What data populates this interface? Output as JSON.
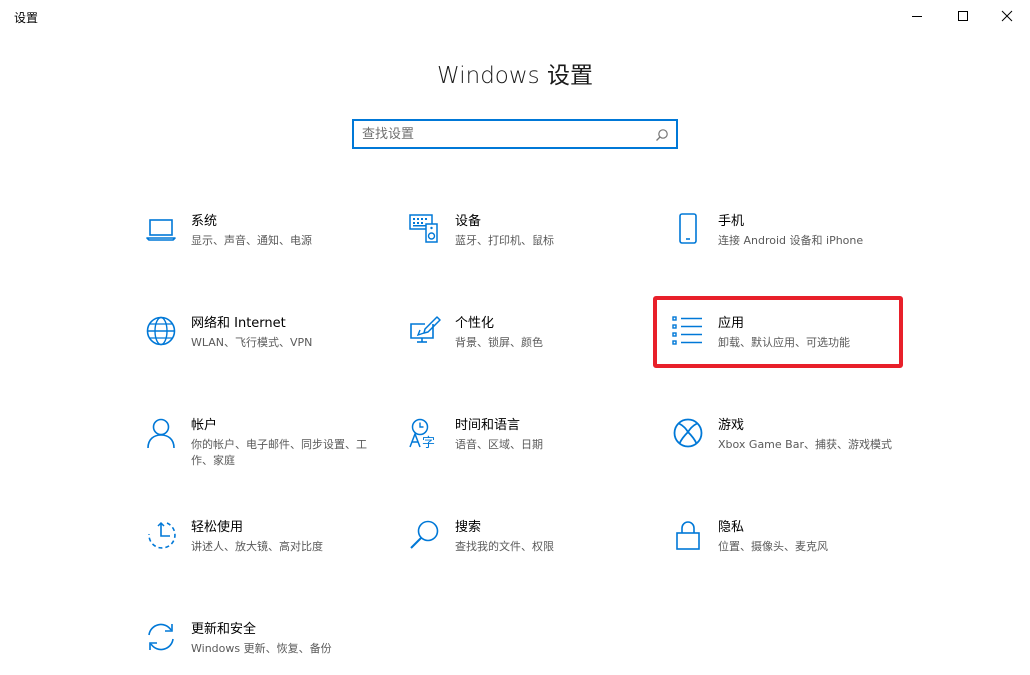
{
  "window": {
    "title": "设置"
  },
  "header": {
    "title": "Windows 设置"
  },
  "search": {
    "placeholder": "查找设置"
  },
  "tiles": [
    {
      "title": "系统",
      "subtitle": "显示、声音、通知、电源",
      "icon": "laptop-icon"
    },
    {
      "title": "设备",
      "subtitle": "蓝牙、打印机、鼠标",
      "icon": "devices-icon"
    },
    {
      "title": "手机",
      "subtitle": "连接 Android 设备和 iPhone",
      "icon": "phone-icon"
    },
    {
      "title": "网络和 Internet",
      "subtitle": "WLAN、飞行模式、VPN",
      "icon": "globe-icon"
    },
    {
      "title": "个性化",
      "subtitle": "背景、锁屏、颜色",
      "icon": "personalization-icon"
    },
    {
      "title": "应用",
      "subtitle": "卸载、默认应用、可选功能",
      "icon": "apps-list-icon"
    },
    {
      "title": "帐户",
      "subtitle": "你的帐户、电子邮件、同步设置、工作、家庭",
      "icon": "person-icon"
    },
    {
      "title": "时间和语言",
      "subtitle": "语音、区域、日期",
      "icon": "time-language-icon"
    },
    {
      "title": "游戏",
      "subtitle": "Xbox Game Bar、捕获、游戏模式",
      "icon": "xbox-icon"
    },
    {
      "title": "轻松使用",
      "subtitle": "讲述人、放大镜、高对比度",
      "icon": "ease-of-access-icon"
    },
    {
      "title": "搜索",
      "subtitle": "查找我的文件、权限",
      "icon": "search-icon"
    },
    {
      "title": "隐私",
      "subtitle": "位置、摄像头、麦克风",
      "icon": "lock-icon"
    },
    {
      "title": "更新和安全",
      "subtitle": "Windows 更新、恢复、备份",
      "icon": "update-icon"
    }
  ],
  "colors": {
    "accent": "#0078d7",
    "highlight": "#e8202a"
  }
}
